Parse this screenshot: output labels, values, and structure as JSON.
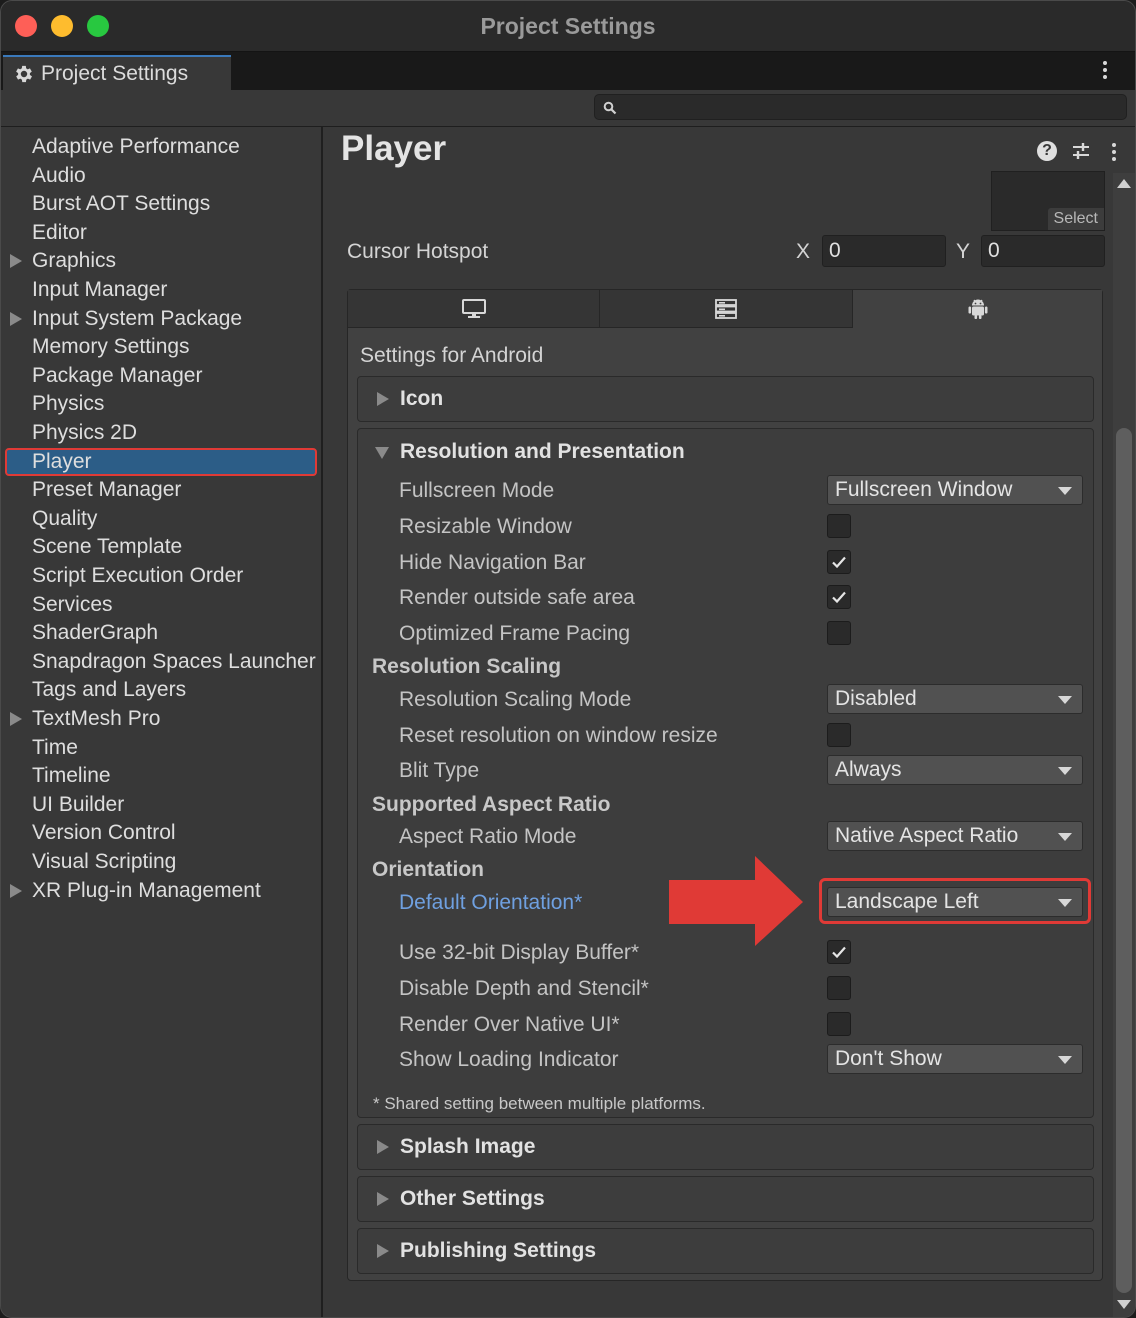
{
  "window": {
    "title": "Project Settings"
  },
  "tab": {
    "label": "Project Settings"
  },
  "search": {
    "placeholder": ""
  },
  "sidebar": {
    "items": [
      {
        "label": "Adaptive Performance",
        "expandable": false
      },
      {
        "label": "Audio",
        "expandable": false
      },
      {
        "label": "Burst AOT Settings",
        "expandable": false
      },
      {
        "label": "Editor",
        "expandable": false
      },
      {
        "label": "Graphics",
        "expandable": true
      },
      {
        "label": "Input Manager",
        "expandable": false
      },
      {
        "label": "Input System Package",
        "expandable": true
      },
      {
        "label": "Memory Settings",
        "expandable": false
      },
      {
        "label": "Package Manager",
        "expandable": false
      },
      {
        "label": "Physics",
        "expandable": false
      },
      {
        "label": "Physics 2D",
        "expandable": false
      },
      {
        "label": "Player",
        "expandable": false,
        "selected": true
      },
      {
        "label": "Preset Manager",
        "expandable": false
      },
      {
        "label": "Quality",
        "expandable": false
      },
      {
        "label": "Scene Template",
        "expandable": false
      },
      {
        "label": "Script Execution Order",
        "expandable": false
      },
      {
        "label": "Services",
        "expandable": false
      },
      {
        "label": "ShaderGraph",
        "expandable": false
      },
      {
        "label": "Snapdragon Spaces Launcher",
        "expandable": false
      },
      {
        "label": "Tags and Layers",
        "expandable": false
      },
      {
        "label": "TextMesh Pro",
        "expandable": true
      },
      {
        "label": "Time",
        "expandable": false
      },
      {
        "label": "Timeline",
        "expandable": false
      },
      {
        "label": "UI Builder",
        "expandable": false
      },
      {
        "label": "Version Control",
        "expandable": false
      },
      {
        "label": "Visual Scripting",
        "expandable": false
      },
      {
        "label": "XR Plug-in Management",
        "expandable": true
      }
    ]
  },
  "main": {
    "title": "Player",
    "cursor_texture": {
      "select_label": "Select"
    },
    "cursor_hotspot": {
      "label": "Cursor Hotspot",
      "x_label": "X",
      "x_value": "0",
      "y_label": "Y",
      "y_value": "0"
    },
    "platform_tabs": [
      {
        "icon": "monitor-icon",
        "active": false
      },
      {
        "icon": "server-icon",
        "active": false
      },
      {
        "icon": "android-icon",
        "active": true
      }
    ],
    "platform_heading": "Settings for Android",
    "sections": {
      "icon": "Icon",
      "resolution": "Resolution and Presentation",
      "splash": "Splash Image",
      "other": "Other Settings",
      "publishing": "Publishing Settings"
    },
    "props": {
      "fullscreen_mode": {
        "label": "Fullscreen Mode",
        "value": "Fullscreen Window"
      },
      "resizable_window": {
        "label": "Resizable Window",
        "checked": false
      },
      "hide_nav_bar": {
        "label": "Hide Navigation Bar",
        "checked": true
      },
      "render_outside_safe": {
        "label": "Render outside safe area",
        "checked": true
      },
      "optimized_frame_pacing": {
        "label": "Optimized Frame Pacing",
        "checked": false
      },
      "resolution_scaling_head": "Resolution Scaling",
      "resolution_scaling_mode": {
        "label": "Resolution Scaling Mode",
        "value": "Disabled"
      },
      "reset_resolution": {
        "label": "Reset resolution on window resize",
        "checked": false
      },
      "blit_type": {
        "label": "Blit Type",
        "value": "Always"
      },
      "aspect_ratio_head": "Supported Aspect Ratio",
      "aspect_ratio_mode": {
        "label": "Aspect Ratio Mode",
        "value": "Native Aspect Ratio"
      },
      "orientation_head": "Orientation",
      "default_orientation": {
        "label": "Default Orientation*",
        "value": "Landscape Left"
      },
      "display_buffer_32": {
        "label": "Use 32-bit Display Buffer*",
        "checked": true
      },
      "disable_depth_stencil": {
        "label": "Disable Depth and Stencil*",
        "checked": false
      },
      "render_over_native": {
        "label": "Render Over Native UI*",
        "checked": false
      },
      "show_loading": {
        "label": "Show Loading Indicator",
        "value": "Don't Show"
      }
    },
    "footnote": "* Shared setting between multiple platforms."
  },
  "colors": {
    "selection": "#2c5d87",
    "highlight_red": "#e03a36",
    "link_blue": "#6fa0e0"
  }
}
